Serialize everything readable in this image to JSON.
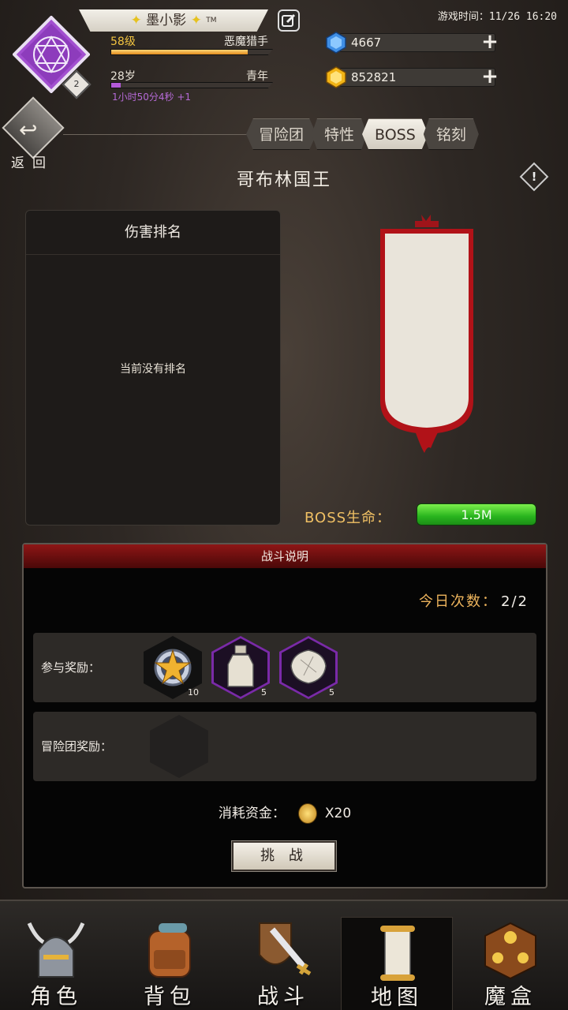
{
  "header": {
    "player_name": "墨小影",
    "trademark": "TM",
    "level_text": "58级",
    "class_name": "恶魔猎手",
    "age_text": "28岁",
    "age_stage": "青年",
    "timer_text": "1小时50分4秒 +1",
    "emblem_badge": "2",
    "game_time": "游戏时间：11/26 16:20",
    "xp_progress": 0.85,
    "age_progress": 0.06
  },
  "resources": {
    "gems": "4667",
    "gold": "852821"
  },
  "nav_back": {
    "label": "返回"
  },
  "tabs": [
    {
      "label": "冒险团"
    },
    {
      "label": "特性"
    },
    {
      "label": "BOSS"
    },
    {
      "label": "铭刻"
    }
  ],
  "boss": {
    "name": "哥布林国王",
    "info_icon": "!",
    "life_label": "BOSS生命：",
    "life_value": "1.5M"
  },
  "ranking": {
    "title": "伤害排名",
    "empty_text": "当前没有排名"
  },
  "battle": {
    "title": "战斗说明",
    "today_label": "今日次数：",
    "today_value": "2/2",
    "participation_label": "参与奖励：",
    "participation_items": [
      {
        "icon": "star-medal-icon",
        "count": "10"
      },
      {
        "icon": "potion-bottle-icon",
        "count": "5"
      },
      {
        "icon": "crystal-gem-icon",
        "count": "5"
      }
    ],
    "team_label": "冒险团奖励：",
    "cost_label": "消耗资金：",
    "cost_value": "X20",
    "challenge_label": "挑 战"
  },
  "bottom_nav": [
    {
      "label": "角色",
      "icon": "helmet-icon"
    },
    {
      "label": "背包",
      "icon": "backpack-icon"
    },
    {
      "label": "战斗",
      "icon": "sword-shield-icon"
    },
    {
      "label": "地图",
      "icon": "scroll-map-icon"
    },
    {
      "label": "魔盒",
      "icon": "magic-box-icon"
    }
  ],
  "colors": {
    "accent_red": "#8e1616",
    "life_green": "#28b41e",
    "gold_text": "#ecb35c"
  }
}
